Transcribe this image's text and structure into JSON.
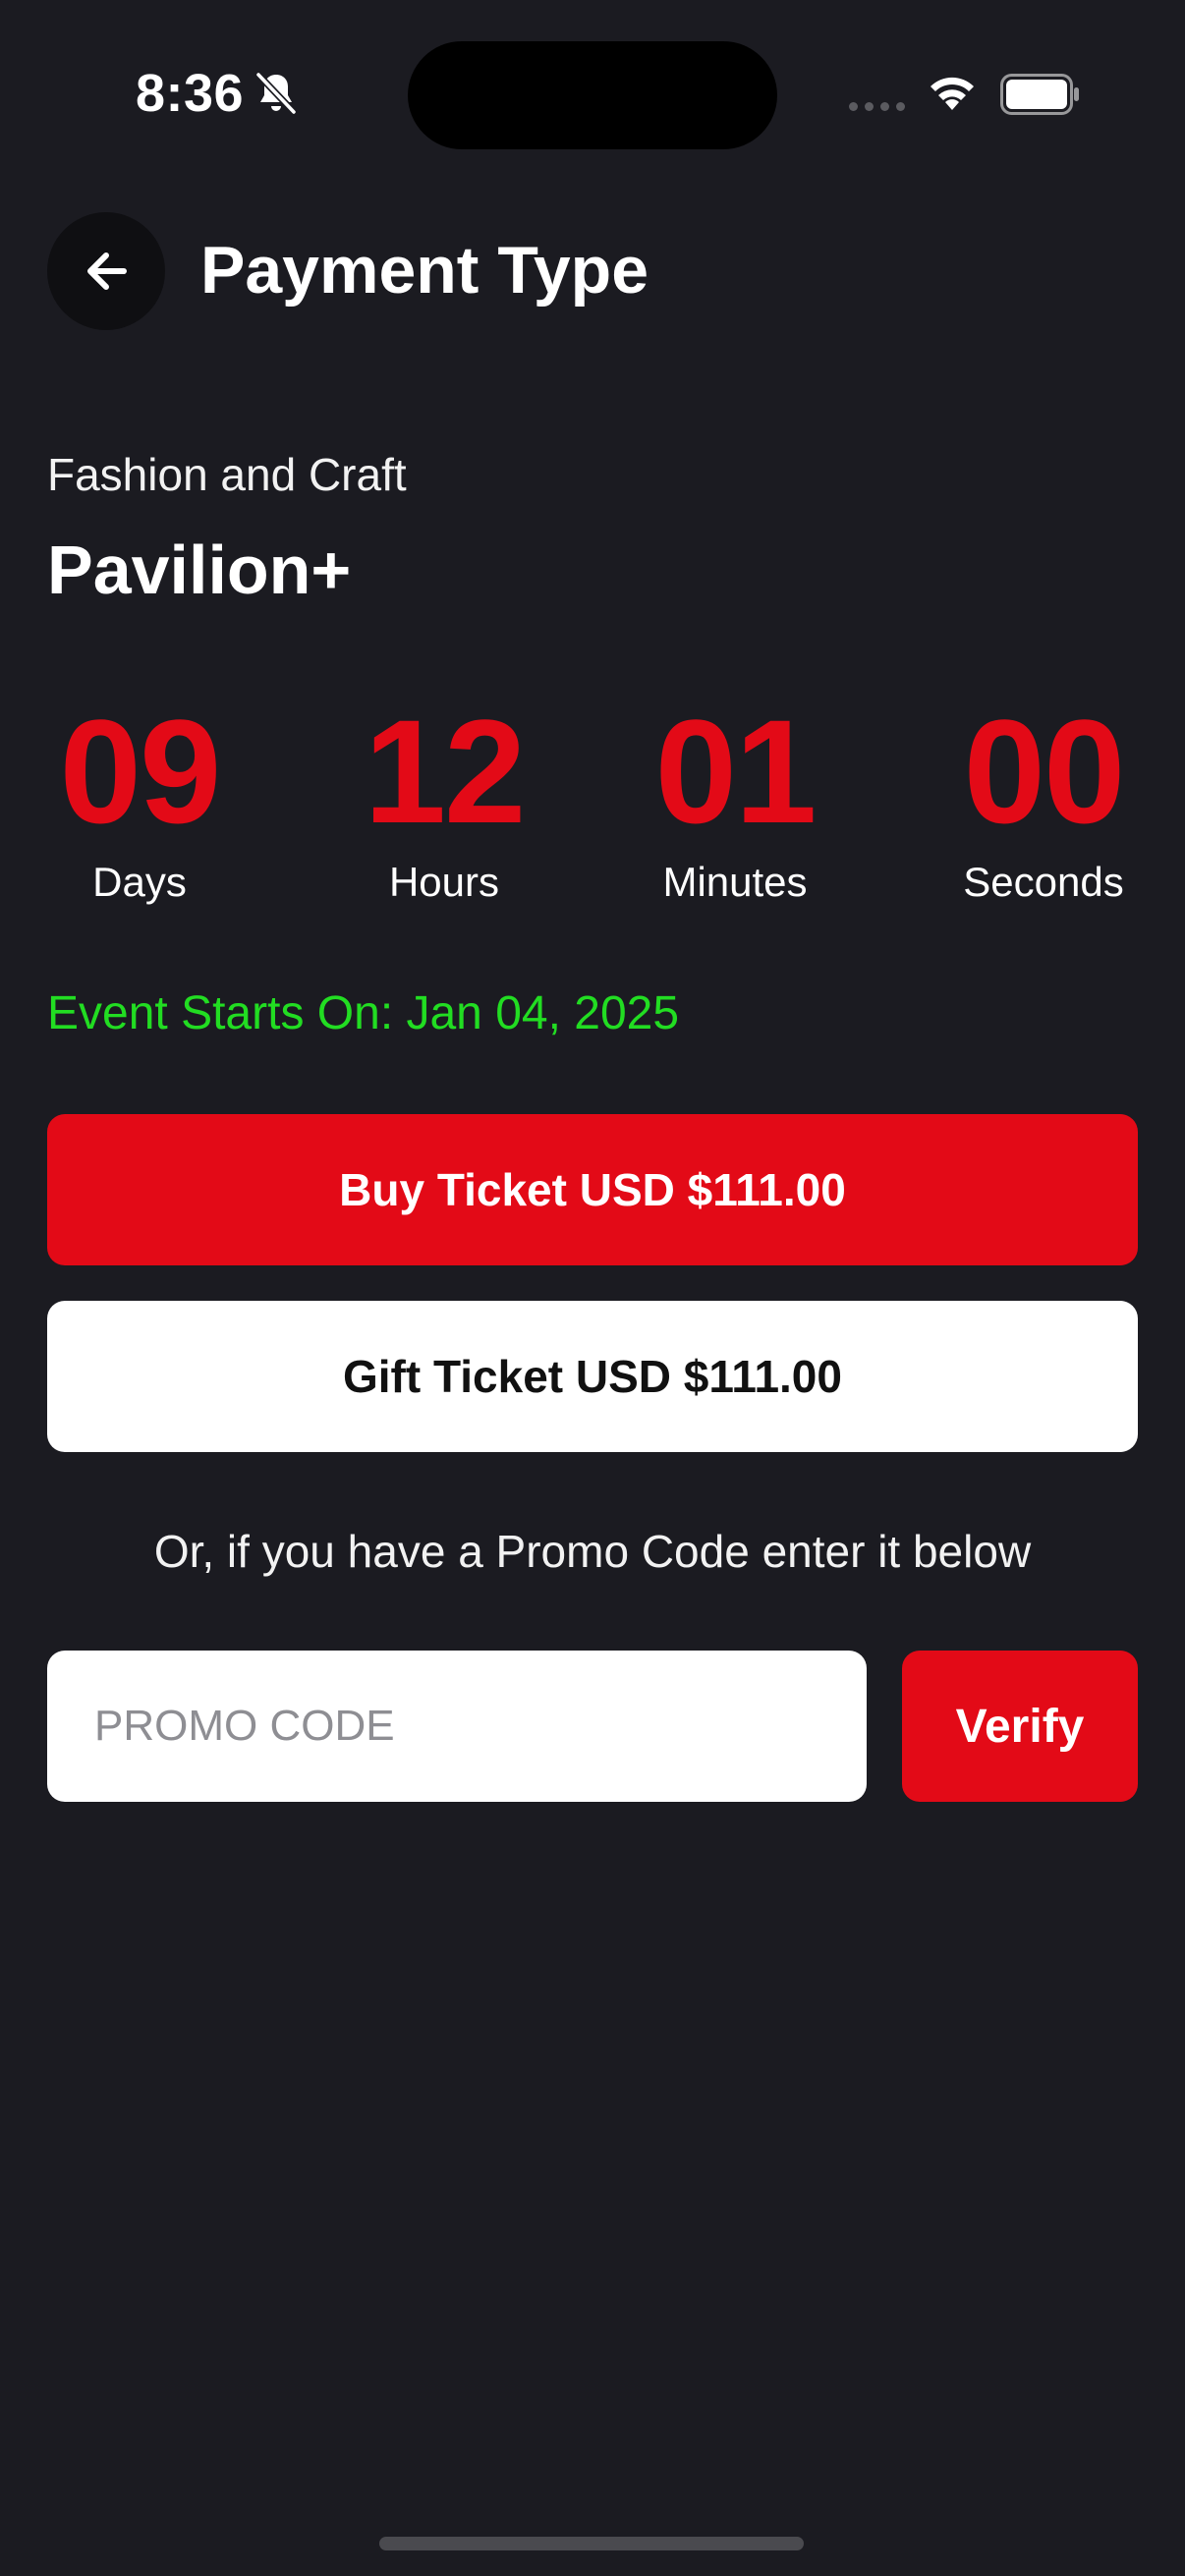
{
  "status_bar": {
    "time": "8:36"
  },
  "header": {
    "title": "Payment Type",
    "back_icon": "arrow-left-icon"
  },
  "event": {
    "category": "Fashion and Craft",
    "name": "Pavilion+",
    "starts_on": "Event Starts On: Jan 04, 2025"
  },
  "countdown": {
    "days": {
      "value": "09",
      "label": "Days"
    },
    "hours": {
      "value": "12",
      "label": "Hours"
    },
    "minutes": {
      "value": "01",
      "label": "Minutes"
    },
    "seconds": {
      "value": "00",
      "label": "Seconds"
    }
  },
  "actions": {
    "buy_label": "Buy Ticket USD $111.00",
    "gift_label": "Gift Ticket USD $111.00"
  },
  "promo": {
    "hint": "Or, if you have a Promo Code enter it below",
    "placeholder": "PROMO CODE",
    "value": "",
    "verify_label": "Verify"
  },
  "colors": {
    "background": "#1b1b21",
    "accent": "#e30a17",
    "success": "#22dd22"
  }
}
